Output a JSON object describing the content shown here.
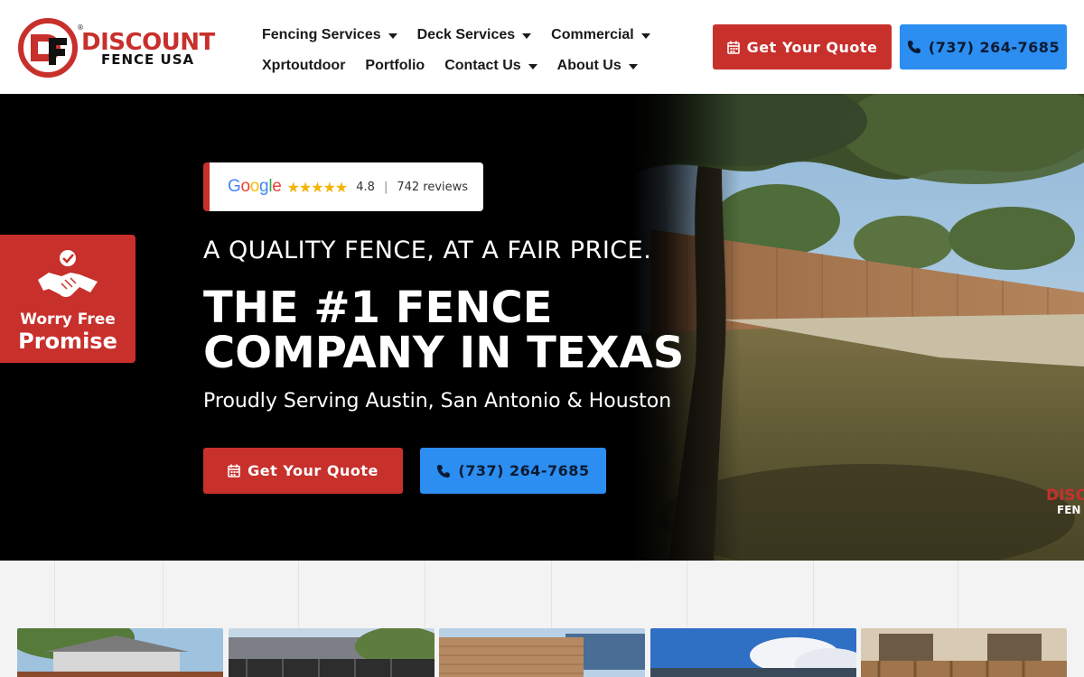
{
  "brand": {
    "line1": "DISCOUNT",
    "line2": "FENCE USA",
    "mark": "DF",
    "registered": "®",
    "red": "#c8302c",
    "blue": "#2b8ef0"
  },
  "nav": {
    "row1": [
      {
        "label": "Fencing Services",
        "dropdown": true
      },
      {
        "label": "Deck Services",
        "dropdown": true
      },
      {
        "label": "Commercial",
        "dropdown": true
      }
    ],
    "row2": [
      {
        "label": "Xprtoutdoor",
        "dropdown": false
      },
      {
        "label": "Portfolio",
        "dropdown": false
      },
      {
        "label": "Contact Us",
        "dropdown": true
      },
      {
        "label": "About Us",
        "dropdown": true
      }
    ]
  },
  "header": {
    "quote_label": "Get Your Quote",
    "phone_label": "(737) 264-7685"
  },
  "hero": {
    "rating": {
      "provider": "Google",
      "stars": "★★★★★",
      "score": "4.8",
      "separator": "|",
      "reviews": "742 reviews"
    },
    "promise": {
      "line1": "Worry Free",
      "line2": "Promise"
    },
    "tagline": "A QUALITY FENCE, AT A FAIR PRICE.",
    "headline_line1": "THE #1 FENCE",
    "headline_line2": "COMPANY IN TEXAS",
    "subline": "Proudly Serving Austin, San Antonio & Houston",
    "quote_label": "Get Your Quote",
    "phone_label": "(737) 264-7685",
    "photo_watermark": "DISC FEN"
  },
  "icons": {
    "calendar": "calendar-icon",
    "phone": "phone-icon",
    "handshake": "handshake-icon",
    "dropdown": "chevron-down-icon"
  }
}
